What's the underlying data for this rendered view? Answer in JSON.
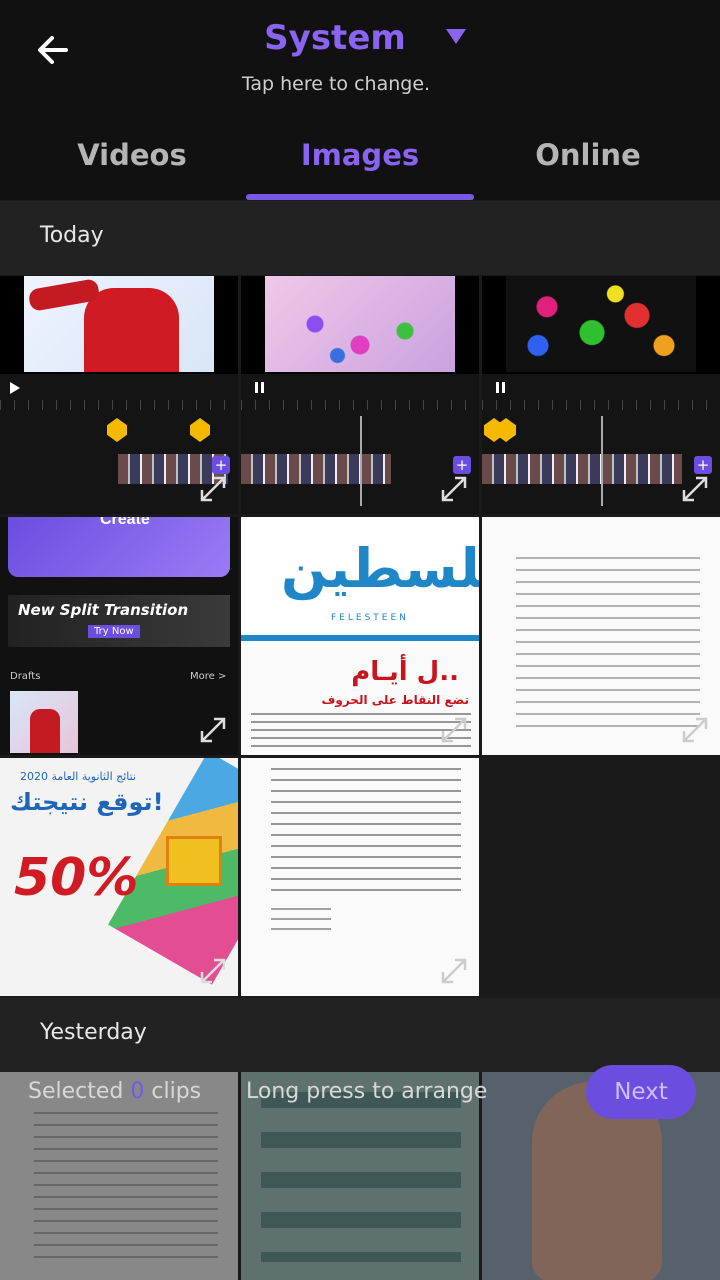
{
  "header": {
    "title": "System",
    "subtitle": "Tap here to change."
  },
  "tabs": [
    {
      "label": "Videos",
      "active": false
    },
    {
      "label": "Images",
      "active": true
    },
    {
      "label": "Online",
      "active": false
    }
  ],
  "sections": [
    {
      "label": "Today"
    },
    {
      "label": "Yesterday"
    }
  ],
  "thumbnails": {
    "create": {
      "label": "Create"
    },
    "transition": {
      "banner": "New Split Transition",
      "badge": "Try Now",
      "left": "Drafts",
      "right": "More >"
    },
    "newspaper": {
      "headline": "فلسطين",
      "subtitle": "FELESTEEN",
      "line1": "ل أيـام..",
      "line2": "تضع النقاط على الحروف"
    },
    "promo": {
      "header": "نتائج الثانوية العامة 2020",
      "title": "توقع نتيجتك!",
      "discount": "50%"
    }
  },
  "footer": {
    "selected_prefix": "Selected",
    "selected_count": "0",
    "selected_suffix": "clips",
    "hint": "Long press to arrange",
    "next_label": "Next"
  },
  "colors": {
    "accent": "#8a63f0",
    "background": "#1a1a1a",
    "header_bg": "#111111"
  }
}
